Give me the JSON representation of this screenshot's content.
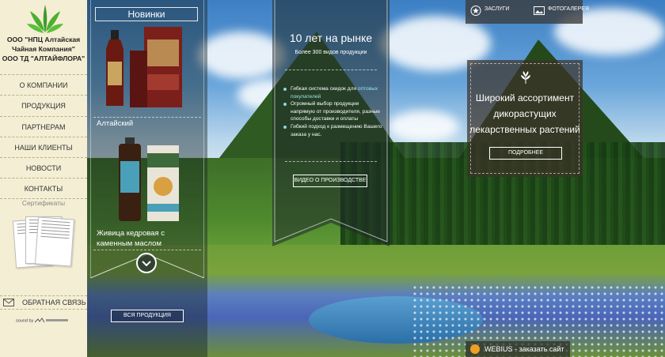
{
  "sidebar": {
    "company_lines": [
      "ООО \"НПЦ Алтайская",
      "Чайная Компания\"",
      "ООО ТД \"АЛТАЙФЛОРА\""
    ],
    "nav": [
      {
        "label": "О компании"
      },
      {
        "label": "Продукция"
      },
      {
        "label": "Партнерам"
      },
      {
        "label": "Наши клиенты"
      },
      {
        "label": "Новости"
      },
      {
        "label": "Контакты"
      }
    ],
    "certs_title": "Сертификаты",
    "feedback": "ОБРАТНАЯ СВЯЗЬ",
    "soundby": "sound by"
  },
  "novelties": {
    "title": "Новинки",
    "products": [
      {
        "name": "Алтайский"
      },
      {
        "name": "Живица кедровая с каменным маслом"
      }
    ],
    "all_button": "ВСЯ ПРОДУКЦИЯ"
  },
  "market": {
    "title": "10 лет на рынке",
    "subtitle": "Более 300 видов продукции",
    "item1_text": "Гибкая система скидок для ",
    "item1_link": "оптовых покупателей",
    "item2": "Огромный выбор продукции напрямую от производителя, разные способы доставки и оплаты",
    "item3": "Гибкий подход к размещению Вашего заказа у нас.",
    "video_button": "ВИДЕО О ПРОИЗВОДСТВЕ"
  },
  "topbar": {
    "awards": "ЗАСЛУГИ",
    "gallery": "ФОТОГАЛЕРЕЯ"
  },
  "assortment": {
    "title": "Широкий ассортимент дикорастущих лекарственных растений",
    "button": "ПОДРОБНЕЕ"
  },
  "webius": {
    "brand": "WEBIUS",
    "text": " - заказать сайт"
  },
  "colors": {
    "sidebar_bg": "#f4eed4",
    "logo_green": "#3f9a2a",
    "link_cyan": "#9fe0ef"
  }
}
